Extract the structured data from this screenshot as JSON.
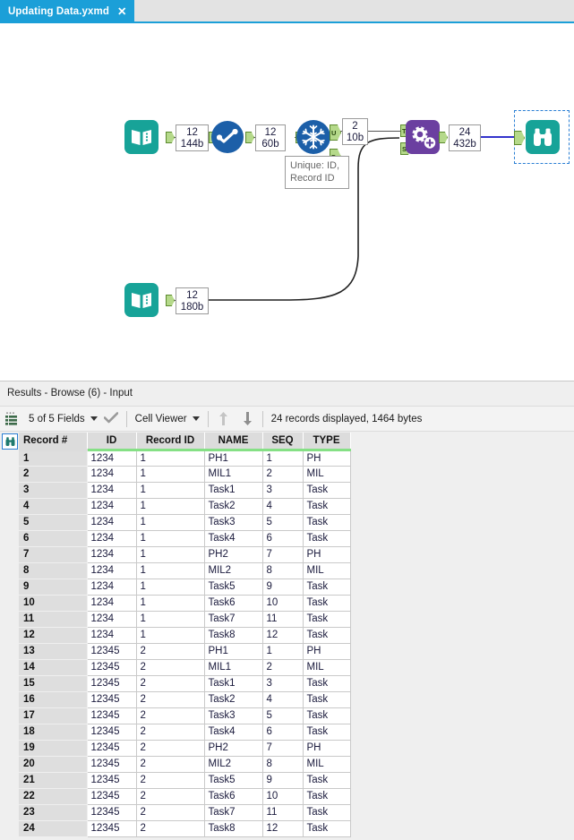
{
  "tab": {
    "title": "Updating Data.yxmd",
    "close_label": "✕"
  },
  "canvas": {
    "annotation": "Unique: ID,\nRecord ID",
    "annotation_line1": "Unique: ID,",
    "annotation_line2": "Record ID",
    "tools": [
      {
        "name": "input-data-1",
        "icon": "book-icon",
        "color": "#17a398"
      },
      {
        "name": "select-1",
        "icon": "check-circle-icon",
        "color": "#1c5fa8"
      },
      {
        "name": "unique-1",
        "icon": "snowflake-icon",
        "color": "#1c5fa8"
      },
      {
        "name": "append-fields-1",
        "icon": "gears-icon",
        "color": "#6b3fa0"
      },
      {
        "name": "browse-6",
        "icon": "binoculars-icon",
        "color": "#17a398"
      },
      {
        "name": "input-data-2",
        "icon": "book-icon",
        "color": "#17a398"
      }
    ],
    "counts": [
      {
        "records": "12",
        "bytes": "144b"
      },
      {
        "records": "12",
        "bytes": "60b"
      },
      {
        "records": "2",
        "bytes": "10b"
      },
      {
        "records": "24",
        "bytes": "432b"
      },
      {
        "records": "12",
        "bytes": "180b"
      }
    ],
    "anchors": {
      "unique_up": "U",
      "unique_down": "D",
      "append_target": "T",
      "append_source": "S"
    }
  },
  "results": {
    "title": "Results - Browse (6) - Input",
    "toolbar": {
      "fields_label": "5 of 5 Fields",
      "viewer_label": "Cell Viewer",
      "status": "24 records displayed, 1464 bytes",
      "up_arrow": "↑",
      "down_arrow": "↓",
      "check": "✔"
    },
    "table": {
      "columns": [
        "Record #",
        "ID",
        "Record ID",
        "NAME",
        "SEQ",
        "TYPE"
      ],
      "rows": [
        [
          "1",
          "1234",
          "1",
          "PH1",
          "1",
          "PH"
        ],
        [
          "2",
          "1234",
          "1",
          "MIL1",
          "2",
          "MIL"
        ],
        [
          "3",
          "1234",
          "1",
          "Task1",
          "3",
          "Task"
        ],
        [
          "4",
          "1234",
          "1",
          "Task2",
          "4",
          "Task"
        ],
        [
          "5",
          "1234",
          "1",
          "Task3",
          "5",
          "Task"
        ],
        [
          "6",
          "1234",
          "1",
          "Task4",
          "6",
          "Task"
        ],
        [
          "7",
          "1234",
          "1",
          "PH2",
          "7",
          "PH"
        ],
        [
          "8",
          "1234",
          "1",
          "MIL2",
          "8",
          "MIL"
        ],
        [
          "9",
          "1234",
          "1",
          "Task5",
          "9",
          "Task"
        ],
        [
          "10",
          "1234",
          "1",
          "Task6",
          "10",
          "Task"
        ],
        [
          "11",
          "1234",
          "1",
          "Task7",
          "11",
          "Task"
        ],
        [
          "12",
          "1234",
          "1",
          "Task8",
          "12",
          "Task"
        ],
        [
          "13",
          "12345",
          "2",
          "PH1",
          "1",
          "PH"
        ],
        [
          "14",
          "12345",
          "2",
          "MIL1",
          "2",
          "MIL"
        ],
        [
          "15",
          "12345",
          "2",
          "Task1",
          "3",
          "Task"
        ],
        [
          "16",
          "12345",
          "2",
          "Task2",
          "4",
          "Task"
        ],
        [
          "17",
          "12345",
          "2",
          "Task3",
          "5",
          "Task"
        ],
        [
          "18",
          "12345",
          "2",
          "Task4",
          "6",
          "Task"
        ],
        [
          "19",
          "12345",
          "2",
          "PH2",
          "7",
          "PH"
        ],
        [
          "20",
          "12345",
          "2",
          "MIL2",
          "8",
          "MIL"
        ],
        [
          "21",
          "12345",
          "2",
          "Task5",
          "9",
          "Task"
        ],
        [
          "22",
          "12345",
          "2",
          "Task6",
          "10",
          "Task"
        ],
        [
          "23",
          "12345",
          "2",
          "Task7",
          "11",
          "Task"
        ],
        [
          "24",
          "12345",
          "2",
          "Task8",
          "12",
          "Task"
        ]
      ]
    }
  },
  "colors": {
    "tab_blue": "#1b9fd8",
    "teal": "#17a398",
    "blue": "#1c5fa8",
    "purple": "#6b3fa0",
    "anchor_green": "#b5d98a",
    "header_green": "#85e085",
    "selection_blue": "#2a7fd4"
  }
}
